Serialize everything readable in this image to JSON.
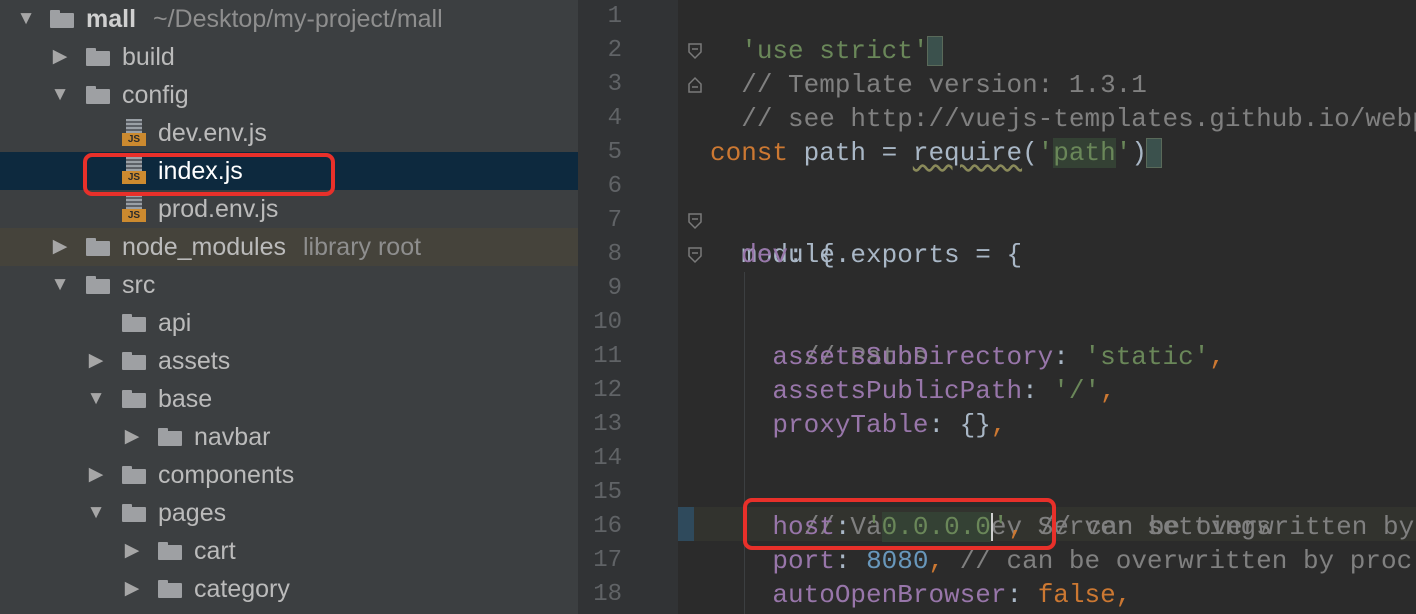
{
  "project_tree": {
    "rows": [
      {
        "label": "mall",
        "path": "~/Desktop/my-project/mall",
        "type": "folder",
        "expanded": true,
        "level": 0
      },
      {
        "label": "build",
        "type": "folder",
        "expanded": false,
        "level": 1
      },
      {
        "label": "config",
        "type": "folder",
        "expanded": true,
        "level": 1
      },
      {
        "label": "dev.env.js",
        "type": "js",
        "level": 2
      },
      {
        "label": "index.js",
        "type": "js",
        "level": 2,
        "selected": true,
        "highlighted": true
      },
      {
        "label": "prod.env.js",
        "type": "js",
        "level": 2
      },
      {
        "label": "node_modules",
        "suffix": "library root",
        "type": "folder",
        "expanded": false,
        "level": 1
      },
      {
        "label": "src",
        "type": "folder",
        "expanded": true,
        "level": 1
      },
      {
        "label": "api",
        "type": "folder",
        "level": 2
      },
      {
        "label": "assets",
        "type": "folder",
        "expanded": false,
        "level": 2
      },
      {
        "label": "base",
        "type": "folder",
        "expanded": true,
        "level": 2
      },
      {
        "label": "navbar",
        "type": "folder",
        "expanded": false,
        "level": 3
      },
      {
        "label": "components",
        "type": "folder",
        "expanded": false,
        "level": 2
      },
      {
        "label": "pages",
        "type": "folder",
        "expanded": true,
        "level": 2
      },
      {
        "label": "cart",
        "type": "folder",
        "expanded": false,
        "level": 3
      },
      {
        "label": "category",
        "type": "folder",
        "expanded": false,
        "level": 3
      }
    ]
  },
  "editor": {
    "line_numbers": [
      "1",
      "2",
      "3",
      "4",
      "5",
      "6",
      "7",
      "8",
      "9",
      "10",
      "11",
      "12",
      "13",
      "14",
      "15",
      "16",
      "17",
      "18"
    ],
    "lines": {
      "l1": {
        "str": "'use strict'"
      },
      "l2": {
        "comment": "// Template version: 1.3.1"
      },
      "l3": {
        "comment": "// see http://vuejs-templates.github.io/webpa"
      },
      "l5": {
        "kw": "const",
        "name": " path = ",
        "fn": "require",
        "open": "(",
        "q1": "'",
        "str": "path",
        "q2": "'",
        "close": ")"
      },
      "l7": {
        "obj": "module.exports = {"
      },
      "l8": {
        "indent": "  ",
        "prop": "dev",
        "rest": ": {"
      },
      "l10": {
        "comment": "    // Paths"
      },
      "l11": {
        "indent": "    ",
        "prop": "assetsSubDirectory",
        "colon": ": ",
        "str": "'static'",
        "comma": ","
      },
      "l12": {
        "indent": "    ",
        "prop": "assetsPublicPath",
        "colon": ": ",
        "str": "'/'",
        "comma": ","
      },
      "l13": {
        "indent": "    ",
        "prop": "proxyTable",
        "colon": ": ",
        "val": "{}",
        "comma": ","
      },
      "l15": {
        "comment": "    // Various Dev Server settings"
      },
      "l16": {
        "indent": "    ",
        "prop": "host",
        "colon": ": ",
        "q1": "'",
        "str": "0.0.0.0",
        "q2": "'",
        "comma": ",",
        "comment": " // can be overwritten by"
      },
      "l17": {
        "indent": "    ",
        "prop": "port",
        "colon": ": ",
        "num": "8080",
        "comma": ",",
        "comment": " // can be overwritten by proc"
      },
      "l18": {
        "indent": "    ",
        "prop": "autoOpenBrowser",
        "colon": ": ",
        "kw": "false",
        "comma": ","
      }
    }
  },
  "colors": {
    "tree_bg": "#3c3f41",
    "editor_bg": "#2b2b2b",
    "selection": "#0d293e",
    "highlight_box": "#e8302a",
    "keyword": "#cc7832",
    "string": "#6a8759",
    "comment": "#808080",
    "property": "#9876aa",
    "number": "#6897bb"
  },
  "icons": {
    "folder": "folder-icon",
    "js_file": "js-file-icon",
    "expand": "chevron-down-icon",
    "collapse": "chevron-right-icon"
  }
}
